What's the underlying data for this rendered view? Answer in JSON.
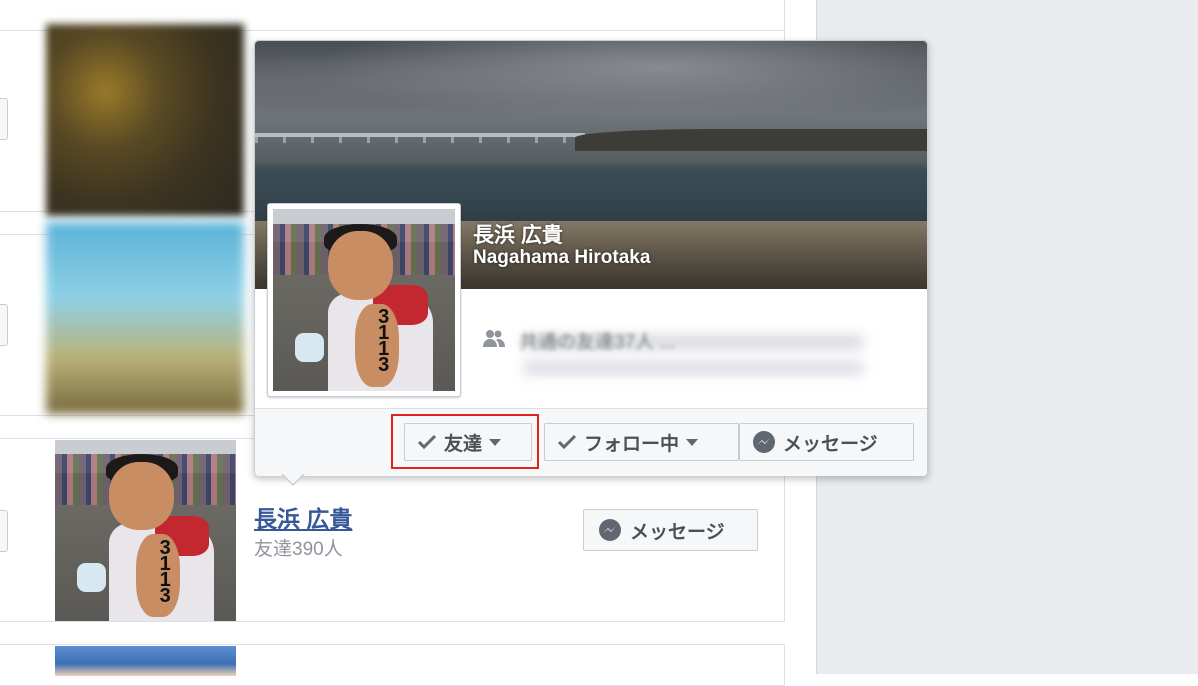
{
  "popup": {
    "name_ja": "長浜 広貴",
    "name_en": "Nagahama Hirotaka",
    "mutual_friends_text": "共通の友達37人 ...",
    "buttons": {
      "friends": "友達",
      "following": "フォロー中",
      "message": "メッセージ"
    }
  },
  "friend_row": {
    "name": "長浜 広貴",
    "friend_count": "友達390人",
    "message_button": "メッセージ"
  },
  "icons": [
    "check-icon",
    "caret-down-icon",
    "messenger-icon",
    "mutual-friends-icon"
  ],
  "colors": {
    "highlight": "#e0231f",
    "link": "#365899",
    "rail": "#e9ebee"
  }
}
